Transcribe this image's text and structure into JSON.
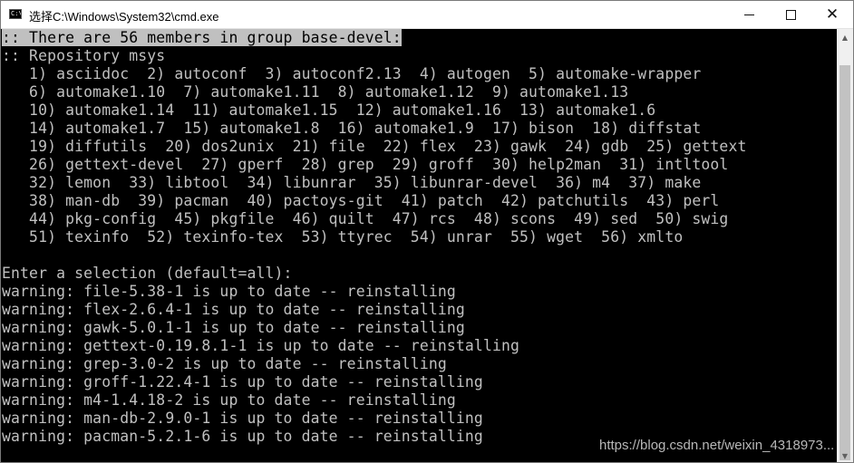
{
  "window": {
    "title": "选择C:\\Windows\\System32\\cmd.exe",
    "app_icon": "cmd-icon",
    "app_icon_text": "C:\\",
    "controls": {
      "minimize_icon": "minimize-icon",
      "maximize_icon": "maximize-icon",
      "close_icon": "close-icon",
      "close_glyph": "✕"
    }
  },
  "console": {
    "lines": [
      ":: There are 56 members in group base-devel:",
      ":: Repository msys",
      "   1) asciidoc  2) autoconf  3) autoconf2.13  4) autogen  5) automake-wrapper",
      "   6) automake1.10  7) automake1.11  8) automake1.12  9) automake1.13",
      "   10) automake1.14  11) automake1.15  12) automake1.16  13) automake1.6",
      "   14) automake1.7  15) automake1.8  16) automake1.9  17) bison  18) diffstat",
      "   19) diffutils  20) dos2unix  21) file  22) flex  23) gawk  24) gdb  25) gettext",
      "   26) gettext-devel  27) gperf  28) grep  29) groff  30) help2man  31) intltool",
      "   32) lemon  33) libtool  34) libunrar  35) libunrar-devel  36) m4  37) make",
      "   38) man-db  39) pacman  40) pactoys-git  41) patch  42) patchutils  43) perl",
      "   44) pkg-config  45) pkgfile  46) quilt  47) rcs  48) scons  49) sed  50) swig",
      "   51) texinfo  52) texinfo-tex  53) ttyrec  54) unrar  55) wget  56) xmlto",
      "",
      "Enter a selection (default=all):",
      "warning: file-5.38-1 is up to date -- reinstalling",
      "warning: flex-2.6.4-1 is up to date -- reinstalling",
      "warning: gawk-5.0.1-1 is up to date -- reinstalling",
      "warning: gettext-0.19.8.1-1 is up to date -- reinstalling",
      "warning: grep-3.0-2 is up to date -- reinstalling",
      "warning: groff-1.22.4-1 is up to date -- reinstalling",
      "warning: m4-1.4.18-2 is up to date -- reinstalling",
      "warning: man-db-2.9.0-1 is up to date -- reinstalling",
      "warning: pacman-5.2.1-6 is up to date -- reinstalling"
    ],
    "selected_line_index": 0,
    "colors": {
      "background": "#000000",
      "foreground": "#c0c0c0",
      "selection_bg": "#c0c0c0",
      "selection_fg": "#000000"
    }
  },
  "scrollbar": {
    "up_glyph": "▲",
    "down_glyph": "▼"
  },
  "watermark": "https://blog.csdn.net/weixin_4318973..."
}
